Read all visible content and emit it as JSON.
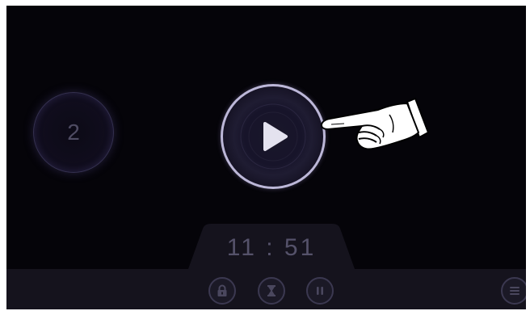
{
  "counter": {
    "value": "2"
  },
  "timer": {
    "text": "11 : 51"
  },
  "colors": {
    "background": "#050409",
    "ring_border": "#bcb7d8",
    "play_triangle": "#e4e2ef",
    "bar": "#15131d",
    "icon": "#4a475e"
  },
  "bottom_bar": {
    "buttons": [
      {
        "icon": "lock-icon"
      },
      {
        "icon": "hourglass-icon"
      },
      {
        "icon": "pause-icon"
      },
      {
        "icon": "menu-icon"
      }
    ]
  },
  "overlay": {
    "icon": "pointing-hand-icon"
  }
}
